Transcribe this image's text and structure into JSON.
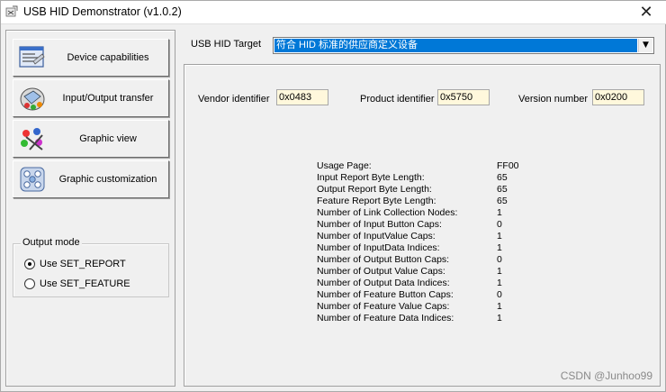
{
  "window": {
    "title": "USB HID Demonstrator (v1.0.2)",
    "close_glyph": "✕"
  },
  "sidebar": {
    "buttons": [
      {
        "label": "Device capabilities",
        "icon": "device-capabilities-icon"
      },
      {
        "label": "Input/Output transfer",
        "icon": "input-output-transfer-icon"
      },
      {
        "label": "Graphic view",
        "icon": "graphic-view-icon"
      },
      {
        "label": "Graphic customization",
        "icon": "graphic-customization-icon"
      }
    ],
    "output_mode": {
      "title": "Output mode",
      "options": [
        {
          "label": "Use SET_REPORT",
          "checked": true
        },
        {
          "label": "Use SET_FEATURE",
          "checked": false
        }
      ]
    }
  },
  "target": {
    "label": "USB HID Target",
    "selected": "符合 HID 标准的供应商定义设备",
    "dropdown_glyph": "▼"
  },
  "ids": {
    "vendor_label": "Vendor identifier",
    "vendor_value": "0x0483",
    "product_label": "Product identifier",
    "product_value": "0x5750",
    "version_label": "Version number",
    "version_value": "0x0200"
  },
  "capabilities": [
    {
      "key": "Usage Page:",
      "value": "FF00"
    },
    {
      "key": "Input Report Byte Length:",
      "value": "65"
    },
    {
      "key": "Output Report Byte Length:",
      "value": "65"
    },
    {
      "key": "Feature Report Byte Length:",
      "value": "65"
    },
    {
      "key": "Number of Link Collection Nodes:",
      "value": "1"
    },
    {
      "key": "Number of Input Button Caps:",
      "value": "0"
    },
    {
      "key": "Number of InputValue Caps:",
      "value": "1"
    },
    {
      "key": "Number of InputData Indices:",
      "value": "1"
    },
    {
      "key": "Number of Output Button Caps:",
      "value": "0"
    },
    {
      "key": "Number of Output Value Caps:",
      "value": "1"
    },
    {
      "key": "Number of Output Data Indices:",
      "value": "1"
    },
    {
      "key": "Number of Feature Button Caps:",
      "value": "0"
    },
    {
      "key": "Number of Feature Value Caps:",
      "value": "1"
    },
    {
      "key": "Number of Feature Data Indices:",
      "value": "1"
    }
  ],
  "watermark": "CSDN @Junhoo99",
  "colors": {
    "selection": "#0078d7",
    "field_bg": "#fff8dc",
    "window_bg": "#f0f0f0"
  }
}
